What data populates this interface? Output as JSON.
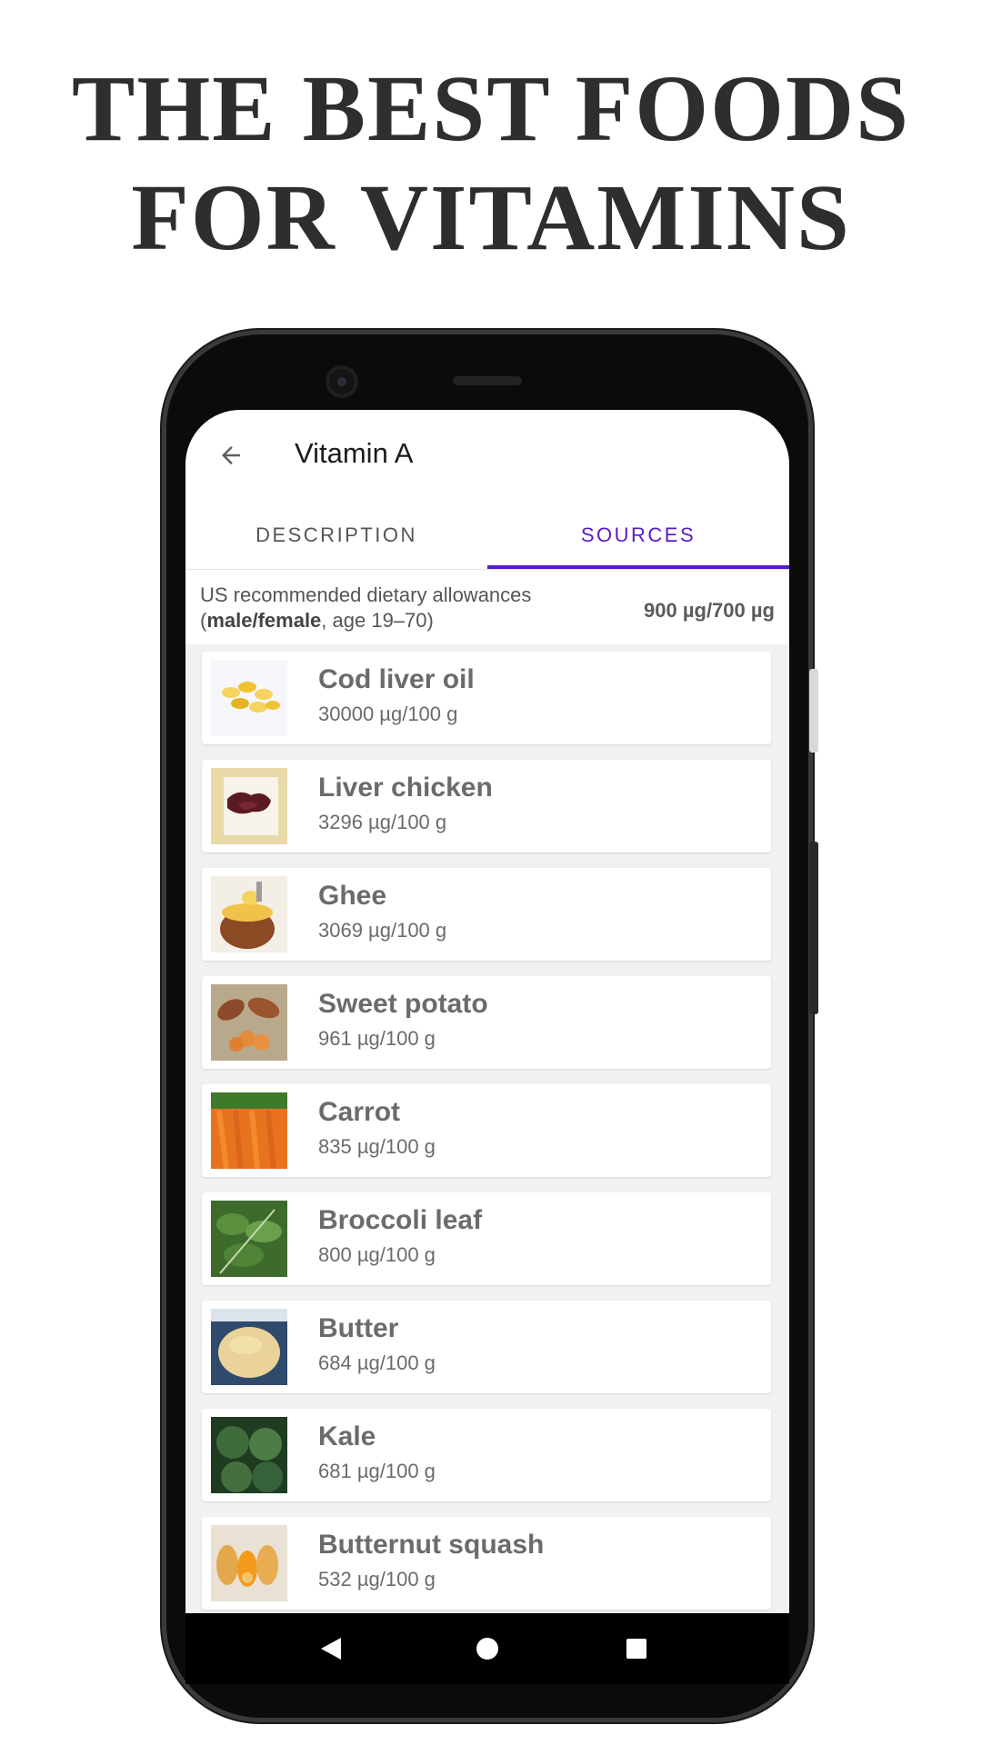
{
  "headline": {
    "line1": "THE BEST FOODS",
    "line2": "FOR VITAMINS"
  },
  "appbar": {
    "title": "Vitamin A",
    "back_icon": "arrow-back-icon"
  },
  "tabs": [
    {
      "label": "DESCRIPTION",
      "active": false
    },
    {
      "label": "SOURCES",
      "active": true
    }
  ],
  "accent_color": "#5a19c9",
  "rda": {
    "line1": "US recommended dietary allowances",
    "paren_open": "(",
    "group": "male/female",
    "age": ", age 19–70)",
    "value": "900 µg/700 µg"
  },
  "foods": [
    {
      "name": "Cod liver oil",
      "value": "30000 µg/100 g",
      "image": "cod-liver-oil-capsules"
    },
    {
      "name": "Liver chicken",
      "value": "3296 µg/100 g",
      "image": "chicken-liver"
    },
    {
      "name": "Ghee",
      "value": "3069 µg/100 g",
      "image": "ghee-pot"
    },
    {
      "name": "Sweet potato",
      "value": "961 µg/100 g",
      "image": "sweet-potatoes"
    },
    {
      "name": "Carrot",
      "value": "835 µg/100 g",
      "image": "carrots"
    },
    {
      "name": "Broccoli leaf",
      "value": "800 µg/100 g",
      "image": "broccoli-leaves"
    },
    {
      "name": "Butter",
      "value": "684 µg/100 g",
      "image": "butter-block"
    },
    {
      "name": "Kale",
      "value": "681 µg/100 g",
      "image": "kale"
    },
    {
      "name": "Butternut squash",
      "value": "532 µg/100 g",
      "image": "butternut-squash"
    }
  ],
  "system_nav": {
    "back": "back-triangle-icon",
    "home": "home-circle-icon",
    "recents": "recents-square-icon"
  }
}
